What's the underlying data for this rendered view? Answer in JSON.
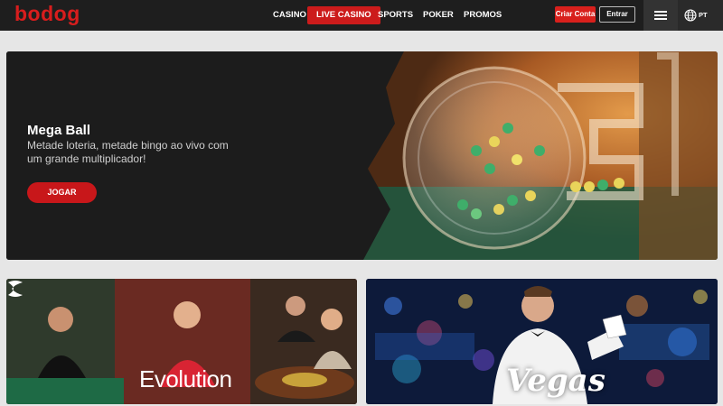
{
  "header": {
    "logo": "bodog",
    "nav": [
      {
        "label": "CASINO"
      },
      {
        "label": "LIVE CASINO"
      },
      {
        "label": "SPORTS"
      },
      {
        "label": "POKER"
      },
      {
        "label": "PROMOS"
      }
    ],
    "criar_label": "Criar Conta",
    "entrar_label": "Entrar",
    "language": "PT"
  },
  "hero": {
    "title": "Mega Ball",
    "subtitle": "Metade loteria, metade bingo ao vivo com um grande multiplicador!",
    "cta": "JOGAR"
  },
  "tiles": [
    {
      "brand": "Evolution"
    },
    {
      "brand": "Vegas"
    }
  ],
  "colors": {
    "brand_red": "#d81d1d",
    "header_bg": "#1e1e1e",
    "page_bg": "#e6e6e6"
  }
}
